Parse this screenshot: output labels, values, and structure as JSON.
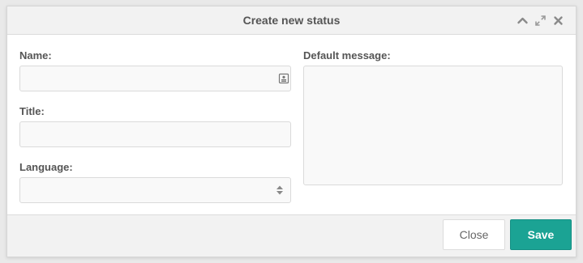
{
  "dialog": {
    "title": "Create new status",
    "controls": {
      "collapse_icon": "chevron-up-icon",
      "maximize_icon": "expand-icon",
      "close_icon": "close-icon"
    }
  },
  "form": {
    "name": {
      "label": "Name:",
      "value": "",
      "placeholder": "",
      "icon": "contact-card-icon"
    },
    "title": {
      "label": "Title:",
      "value": "",
      "placeholder": ""
    },
    "language": {
      "label": "Language:",
      "value": "",
      "icon": "sort-updown-icon"
    },
    "default_message": {
      "label": "Default message:",
      "value": "",
      "placeholder": ""
    }
  },
  "footer": {
    "close_label": "Close",
    "save_label": "Save"
  },
  "colors": {
    "accent": "#1ba394",
    "dialog_bg": "#ffffff",
    "chrome_bg": "#f2f2f2",
    "input_bg": "#f9f9f9"
  }
}
